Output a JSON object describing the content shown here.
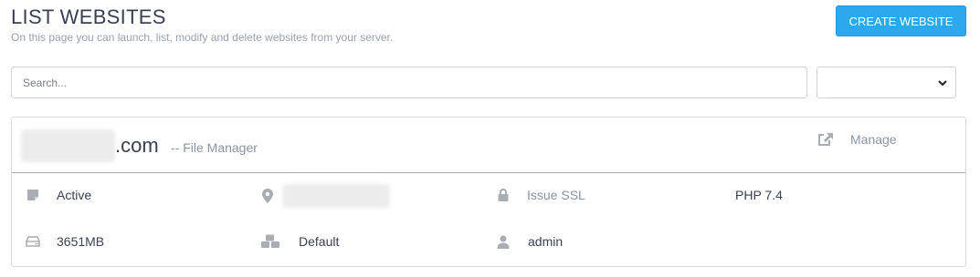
{
  "header": {
    "title": "LIST WEBSITES",
    "subtitle": "On this page you can launch, list, modify and delete websites from your server.",
    "create_button": "CREATE WEBSITE"
  },
  "search": {
    "placeholder": "Search...",
    "value": ""
  },
  "filter": {
    "selected": ""
  },
  "website": {
    "domain_suffix": ".com",
    "file_manager_link": "-- File Manager",
    "manage_label": "Manage",
    "status": "Active",
    "ssl_label": "Issue SSL",
    "php_version": "PHP 7.4",
    "disk_usage": "3651MB",
    "package": "Default",
    "owner": "admin"
  },
  "colors": {
    "accent": "#2ca8ef",
    "muted_text": "#8a93a6",
    "icon_gray": "#a9adb4",
    "title_text": "#3a3f51"
  },
  "icons": [
    "sticky-note-icon",
    "map-marker-icon",
    "lock-icon",
    "hdd-icon",
    "cubes-icon",
    "user-icon",
    "external-link-icon",
    "chevron-down-icon"
  ]
}
